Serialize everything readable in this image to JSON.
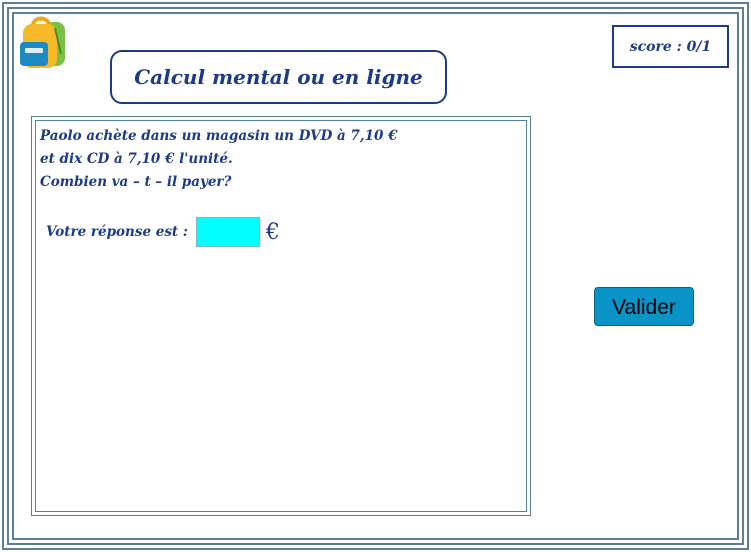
{
  "header": {
    "title": "Calcul mental ou en ligne",
    "score": "score : 0/1"
  },
  "question": {
    "lines": [
      "Paolo achète dans un magasin un DVD à 7,10 € ",
      "et dix CD à 7,10 € l'unité.",
      "Combien va – t – il payer?"
    ],
    "answer_label": "Votre réponse est :",
    "answer_value": "",
    "currency": "€"
  },
  "actions": {
    "validate_label": "Valider"
  },
  "colors": {
    "frame": "#5c7f94",
    "text": "#1d3a8a",
    "input_bg": "#00ffff",
    "button_bg": "#0993c7"
  },
  "icons": {
    "logo": "backpack-icon"
  }
}
